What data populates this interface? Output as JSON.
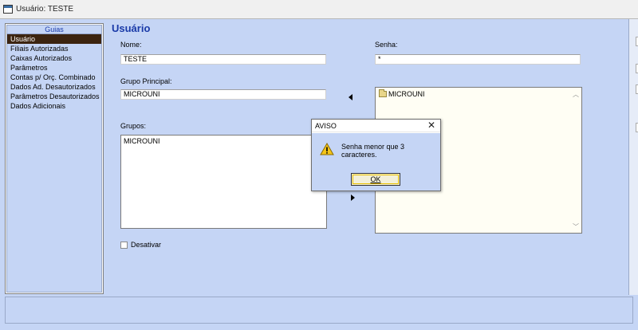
{
  "window": {
    "title": "Usuário: TESTE"
  },
  "sidebar": {
    "header": "Guias",
    "items": [
      {
        "label": "Usuário",
        "active": true
      },
      {
        "label": "Filiais Autorizadas"
      },
      {
        "label": "Caixas Autorizados"
      },
      {
        "label": "Parâmetros"
      },
      {
        "label": "Contas p/ Orç. Combinado"
      },
      {
        "label": "Dados Ad. Desautorizados"
      },
      {
        "label": "Parâmetros Desautorizados"
      },
      {
        "label": "Dados Adicionais"
      }
    ]
  },
  "form": {
    "page_title": "Usuário",
    "nome_label": "Nome:",
    "nome_value": "TESTE",
    "senha_label": "Senha:",
    "senha_value": "*",
    "grupo_principal_label": "Grupo Principal:",
    "grupo_principal_value": "MICROUNI",
    "grupos_label": "Grupos:",
    "grupos_items": [
      "MICROUNI"
    ],
    "tree_items": [
      "MICROUNI"
    ],
    "desativar_label": "Desativar",
    "desativar_checked": false
  },
  "dialog": {
    "title": "AVISO",
    "message": "Senha menor que 3 caracteres.",
    "ok_label": "OK",
    "icon": "warning-icon"
  },
  "colors": {
    "background": "#c5d5f5",
    "title_blue": "#1a3aa8",
    "active_item": "#3c2410"
  }
}
